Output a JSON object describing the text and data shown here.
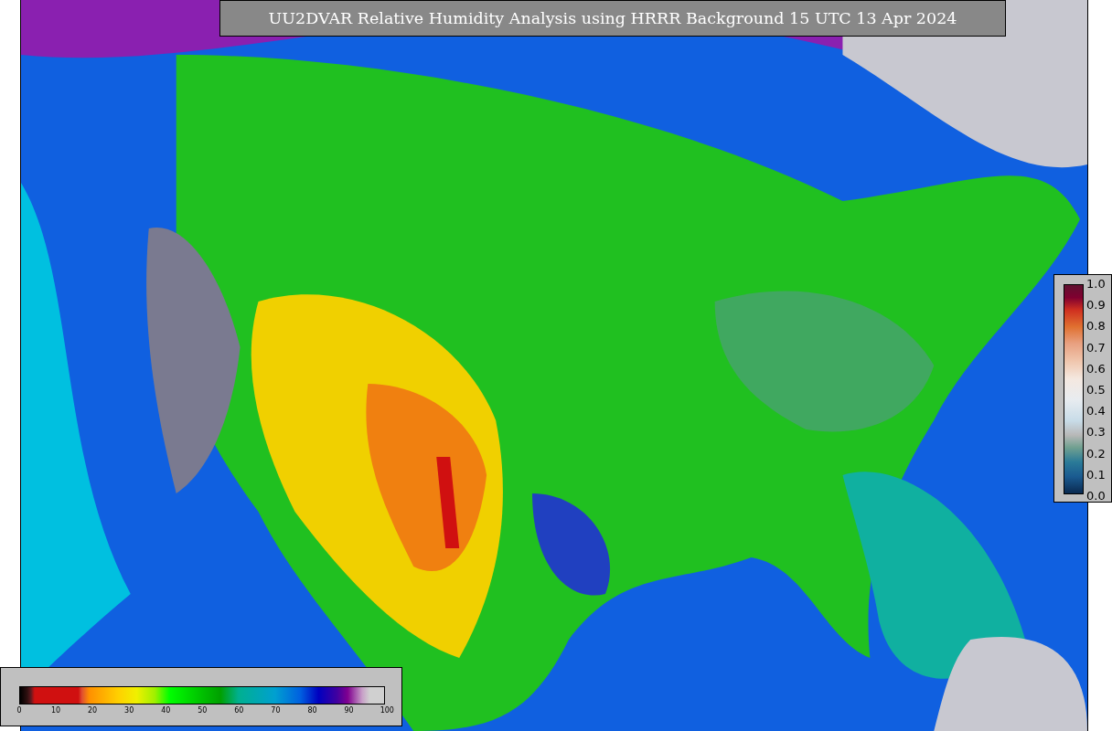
{
  "title": "UU2DVAR Relative Humidity Analysis using HRRR Background 15 UTC 13 Apr 2024",
  "innovation_colorbar": {
    "ticks": [
      "1.0",
      "0.9",
      "0.8",
      "0.7",
      "0.6",
      "0.5",
      "0.4",
      "0.3",
      "0.2",
      "0.1",
      "0.0"
    ]
  },
  "humidity_colorbar": {
    "ticks": [
      "0",
      "10",
      "20",
      "30",
      "40",
      "50",
      "60",
      "70",
      "80",
      "90",
      "100"
    ]
  }
}
